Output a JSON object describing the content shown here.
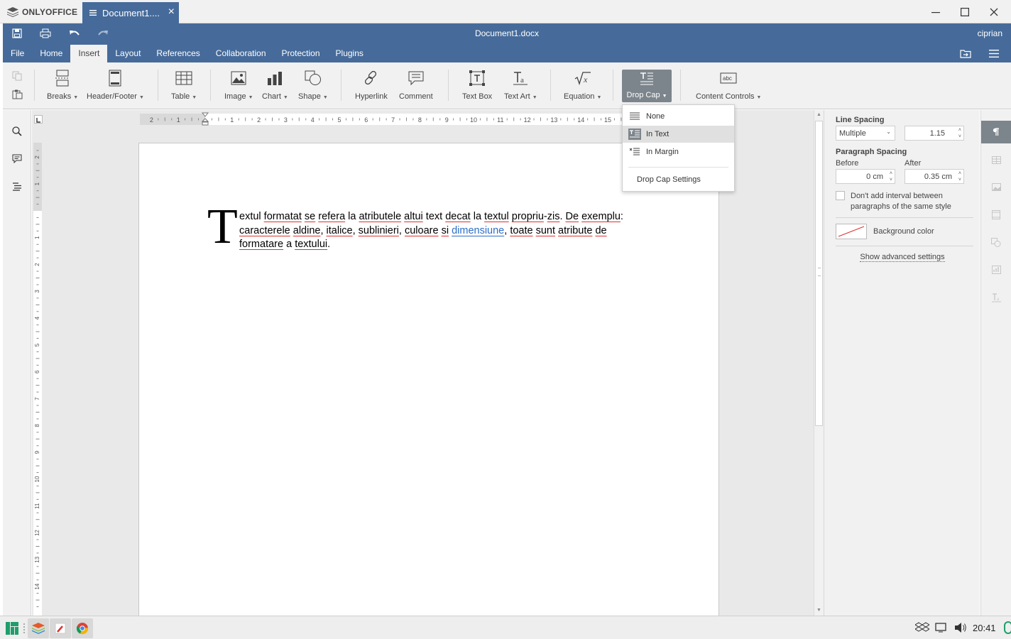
{
  "titlebar": {
    "app_name": "ONLYOFFICE",
    "tab_title": "Document1...."
  },
  "header": {
    "doc_title": "Document1.docx",
    "user": "ciprian",
    "menu": [
      "File",
      "Home",
      "Insert",
      "Layout",
      "References",
      "Collaboration",
      "Protection",
      "Plugins"
    ],
    "active_menu": "Insert"
  },
  "toolbar": {
    "breaks": "Breaks",
    "header_footer": "Header/Footer",
    "table": "Table",
    "image": "Image",
    "chart": "Chart",
    "shape": "Shape",
    "hyperlink": "Hyperlink",
    "comment": "Comment",
    "text_box": "Text Box",
    "text_art": "Text Art",
    "equation": "Equation",
    "drop_cap": "Drop Cap",
    "content_controls": "Content Controls"
  },
  "dropcap_menu": {
    "none": "None",
    "in_text": "In Text",
    "in_margin": "In Margin",
    "settings": "Drop Cap Settings",
    "selected": "In Text"
  },
  "ruler": {
    "h_ticks": [
      "2",
      "1",
      "1",
      "2",
      "3",
      "4",
      "5",
      "6",
      "7",
      "8",
      "9",
      "10",
      "11",
      "12",
      "13",
      "14",
      "15"
    ],
    "v_ticks": [
      "2",
      "1",
      "1",
      "2",
      "3",
      "4",
      "5",
      "6",
      "7",
      "8",
      "9",
      "10",
      "11",
      "12",
      "13",
      "14",
      "15"
    ]
  },
  "document": {
    "drop_cap_letter": "T",
    "line1": [
      {
        "t": "extul",
        "s": false
      },
      {
        "t": " ",
        "s": false
      },
      {
        "t": "formatat",
        "s": true
      },
      {
        "t": " ",
        "s": false
      },
      {
        "t": "se",
        "s": true
      },
      {
        "t": " ",
        "s": false
      },
      {
        "t": "refera",
        "s": true
      },
      {
        "t": " la ",
        "s": false
      },
      {
        "t": "atributele",
        "s": true
      },
      {
        "t": " ",
        "s": false
      },
      {
        "t": "altui",
        "s": true
      },
      {
        "t": " text ",
        "s": false
      },
      {
        "t": "decat",
        "s": true
      },
      {
        "t": " la ",
        "s": false
      },
      {
        "t": "textul",
        "s": true
      },
      {
        "t": " ",
        "s": false
      },
      {
        "t": "propriu",
        "s": true
      },
      {
        "t": "-",
        "s": false
      },
      {
        "t": "zis",
        "s": true
      },
      {
        "t": ". ",
        "s": false
      },
      {
        "t": "De",
        "s": true
      },
      {
        "t": " ",
        "s": false
      },
      {
        "t": "exemplu",
        "s": true
      },
      {
        "t": ":",
        "s": false
      }
    ],
    "line2": [
      {
        "t": "caracterele",
        "s": true
      },
      {
        "t": " ",
        "s": false
      },
      {
        "t": "aldine",
        "s": true
      },
      {
        "t": ", ",
        "s": false
      },
      {
        "t": "italice",
        "s": true
      },
      {
        "t": ", ",
        "s": false
      },
      {
        "t": "sublinieri",
        "s": true
      },
      {
        "t": ", ",
        "s": false
      },
      {
        "t": "culoare",
        "s": true
      },
      {
        "t": " ",
        "s": false
      },
      {
        "t": "si",
        "s": true
      },
      {
        "t": " ",
        "s": false
      },
      {
        "t": "dimensiune",
        "s": "link"
      },
      {
        "t": ", ",
        "s": false
      },
      {
        "t": "toate",
        "s": true
      },
      {
        "t": " ",
        "s": false
      },
      {
        "t": "sunt",
        "s": true
      },
      {
        "t": " ",
        "s": false
      },
      {
        "t": "atribute",
        "s": true
      },
      {
        "t": " ",
        "s": false
      },
      {
        "t": "de",
        "s": true
      }
    ],
    "line3": [
      {
        "t": "formatare",
        "s": true
      },
      {
        "t": " a ",
        "s": false
      },
      {
        "t": "textului",
        "s": true
      },
      {
        "t": ".",
        "s": false
      }
    ]
  },
  "right_panel": {
    "line_spacing_title": "Line Spacing",
    "line_spacing_mode": "Multiple",
    "line_spacing_value": "1.15",
    "paragraph_spacing_title": "Paragraph Spacing",
    "before_label": "Before",
    "after_label": "After",
    "before_value": "0 cm",
    "after_value": "0.35 cm",
    "checkbox_label_1": "Don't add interval between",
    "checkbox_label_2": "paragraphs of the same style",
    "background_color": "Background color",
    "advanced": "Show advanced settings"
  },
  "taskbar": {
    "clock": "20:41"
  },
  "colors": {
    "header_blue": "#466b9a",
    "spell_red": "#e03030",
    "link_blue": "#2d6ec5"
  }
}
